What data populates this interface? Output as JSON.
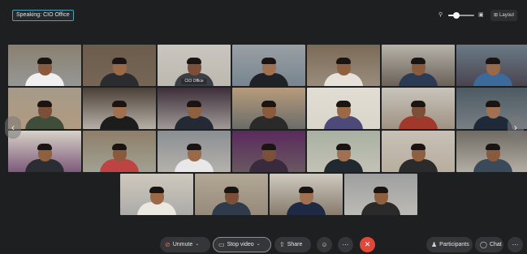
{
  "speaking": "Speaking: CIO Office",
  "zoom": {
    "minus_icon": "zoom-out-icon",
    "plus_icon": "zoom-in-icon",
    "level": 0.3
  },
  "layout_label": "Layout",
  "colors": {
    "end_call": "#e2473a",
    "active_speaker_border": "#cfe4ea",
    "speaking_border": "#45a3b7"
  },
  "active_speaker_label": "CIO Office",
  "participant_rows": [
    {
      "count": 7,
      "offset": 0
    },
    {
      "count": 7,
      "offset": 0
    },
    {
      "count": 7,
      "offset": 0
    },
    {
      "count": 4,
      "offset": 138
    }
  ],
  "controls": {
    "unmute": "Unmute",
    "stop_video": "Stop video",
    "share": "Share",
    "participants": "Participants",
    "chat": "Chat"
  }
}
